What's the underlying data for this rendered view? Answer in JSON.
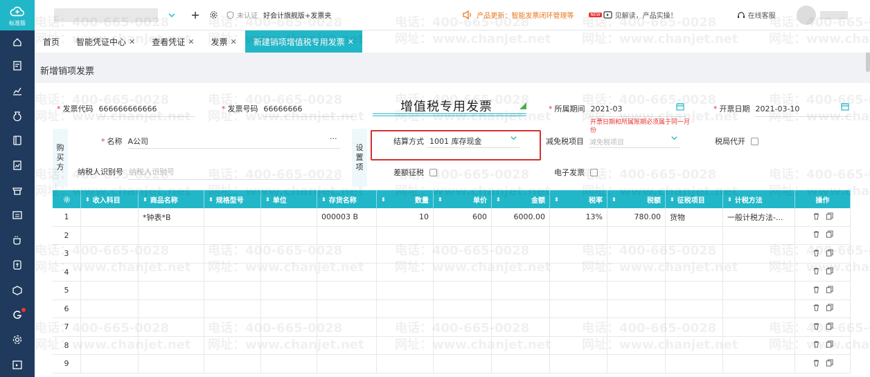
{
  "sidebar": {
    "logo_text": "标准版",
    "items": [
      "home-icon",
      "voucher-icon",
      "chart-icon",
      "money-bag-icon",
      "ledger-icon",
      "report-icon",
      "shop-icon",
      "invoice-icon",
      "cup-icon",
      "bill-icon",
      "box-icon",
      "app-g-icon",
      "gear-icon",
      "calendar-icon"
    ]
  },
  "topbar": {
    "cert_status": "未认证",
    "product_name": "好会计旗舰版+发票夹",
    "update_notice": "产品更新：智能发票闭环管理等",
    "new_badge": "NEW",
    "promo": "见解读，产品实操！",
    "online_service": "在线客服"
  },
  "tabs": [
    {
      "label": "首页",
      "closable": false,
      "active": false
    },
    {
      "label": "智能凭证中心",
      "closable": true,
      "active": false
    },
    {
      "label": "查看凭证",
      "closable": true,
      "active": false
    },
    {
      "label": "发票",
      "closable": true,
      "active": false
    },
    {
      "label": "新建销项增值税专用发票",
      "closable": true,
      "active": true
    }
  ],
  "page": {
    "title": "新增销项发票"
  },
  "invoice": {
    "title": "增值税专用发票",
    "code_label": "发票代码",
    "code_value": "666666666666",
    "number_label": "发票号码",
    "number_value": "66666666",
    "period_label": "所属期间",
    "period_value": "2021-03",
    "issue_date_label": "开票日期",
    "issue_date_value": "2021-03-10",
    "date_warning": "开票日期和所属账期必须属于同一月份"
  },
  "buyer": {
    "section_label": "购买方",
    "name_label": "名称",
    "name_value": "A公司",
    "more": "···",
    "taxid_label": "纳税人识别号",
    "taxid_placeholder": "纳税人识别号"
  },
  "settings": {
    "section_label": "设置项",
    "settle_label": "结算方式",
    "settle_value": "1001 库存现金",
    "exempt_label": "减免税项目",
    "exempt_placeholder": "减免税项目",
    "agent_label": "税局代开",
    "diff_label": "差额征税",
    "einvoice_label": "电子发票"
  },
  "grid": {
    "headers": [
      "收入科目",
      "商品名称",
      "规格型号",
      "单位",
      "存货名称",
      "数量",
      "单价",
      "金额",
      "税率",
      "税额",
      "征税项目",
      "计税方法",
      "操作"
    ],
    "rows": [
      {
        "no": "1",
        "income": "",
        "product": "*钟表*B",
        "spec": "",
        "unit": "",
        "inventory": "000003 B",
        "qty": "10",
        "price": "600",
        "amount": "6000.00",
        "rate": "13%",
        "tax": "780.00",
        "item": "货物",
        "method": "一般计税方法-..."
      },
      {
        "no": "2",
        "income": "",
        "product": "",
        "spec": "",
        "unit": "",
        "inventory": "",
        "qty": "",
        "price": "",
        "amount": "",
        "rate": "",
        "tax": "",
        "item": "",
        "method": ""
      },
      {
        "no": "3",
        "income": "",
        "product": "",
        "spec": "",
        "unit": "",
        "inventory": "",
        "qty": "",
        "price": "",
        "amount": "",
        "rate": "",
        "tax": "",
        "item": "",
        "method": ""
      },
      {
        "no": "4",
        "income": "",
        "product": "",
        "spec": "",
        "unit": "",
        "inventory": "",
        "qty": "",
        "price": "",
        "amount": "",
        "rate": "",
        "tax": "",
        "item": "",
        "method": ""
      },
      {
        "no": "5",
        "income": "",
        "product": "",
        "spec": "",
        "unit": "",
        "inventory": "",
        "qty": "",
        "price": "",
        "amount": "",
        "rate": "",
        "tax": "",
        "item": "",
        "method": ""
      },
      {
        "no": "6",
        "income": "",
        "product": "",
        "spec": "",
        "unit": "",
        "inventory": "",
        "qty": "",
        "price": "",
        "amount": "",
        "rate": "",
        "tax": "",
        "item": "",
        "method": ""
      },
      {
        "no": "7",
        "income": "",
        "product": "",
        "spec": "",
        "unit": "",
        "inventory": "",
        "qty": "",
        "price": "",
        "amount": "",
        "rate": "",
        "tax": "",
        "item": "",
        "method": ""
      },
      {
        "no": "8",
        "income": "",
        "product": "",
        "spec": "",
        "unit": "",
        "inventory": "",
        "qty": "",
        "price": "",
        "amount": "",
        "rate": "",
        "tax": "",
        "item": "",
        "method": ""
      },
      {
        "no": "9",
        "income": "",
        "product": "",
        "spec": "",
        "unit": "",
        "inventory": "",
        "qty": "",
        "price": "",
        "amount": "",
        "rate": "",
        "tax": "",
        "item": "",
        "method": ""
      }
    ]
  },
  "watermark": {
    "phone": "电话：400-665-0028",
    "site": "网址：www.chanjet.net"
  },
  "colors": {
    "accent": "#22b7c8",
    "sidebar": "#1f3a5c",
    "required": "#e33333",
    "highlight_box": "#d32f2f"
  }
}
